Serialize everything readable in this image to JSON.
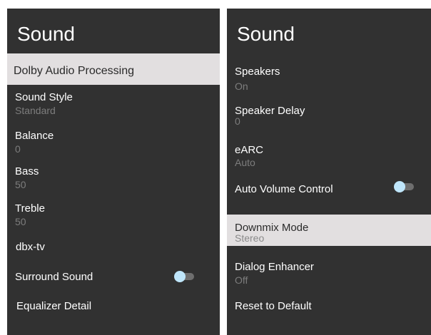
{
  "left_panel": {
    "title": "Sound",
    "items": [
      {
        "label": "Dolby Audio Processing"
      },
      {
        "label": "Sound Style",
        "value": "Standard"
      },
      {
        "label": "Balance",
        "value": "0"
      },
      {
        "label": "Bass",
        "value": "50"
      },
      {
        "label": "Treble",
        "value": "50"
      },
      {
        "label": "dbx-tv"
      },
      {
        "label": "Surround Sound",
        "toggle": "off"
      },
      {
        "label": "Equalizer Detail"
      }
    ]
  },
  "right_panel": {
    "title": "Sound",
    "items": [
      {
        "label": "Speakers",
        "value": "On"
      },
      {
        "label": "Speaker Delay",
        "value": "0"
      },
      {
        "label": "eARC",
        "value": "Auto"
      },
      {
        "label": "Auto Volume Control",
        "toggle": "off"
      },
      {
        "label": "Downmix Mode",
        "value": "Stereo"
      },
      {
        "label": "Dialog Enhancer",
        "value": "Off"
      },
      {
        "label": "Reset to Default"
      }
    ]
  },
  "colors": {
    "panel_background": "#313131",
    "highlight_background": "#e2dfe0",
    "secondary_text": "#7d7d7d",
    "toggle_knob": "#bfe6fb"
  }
}
